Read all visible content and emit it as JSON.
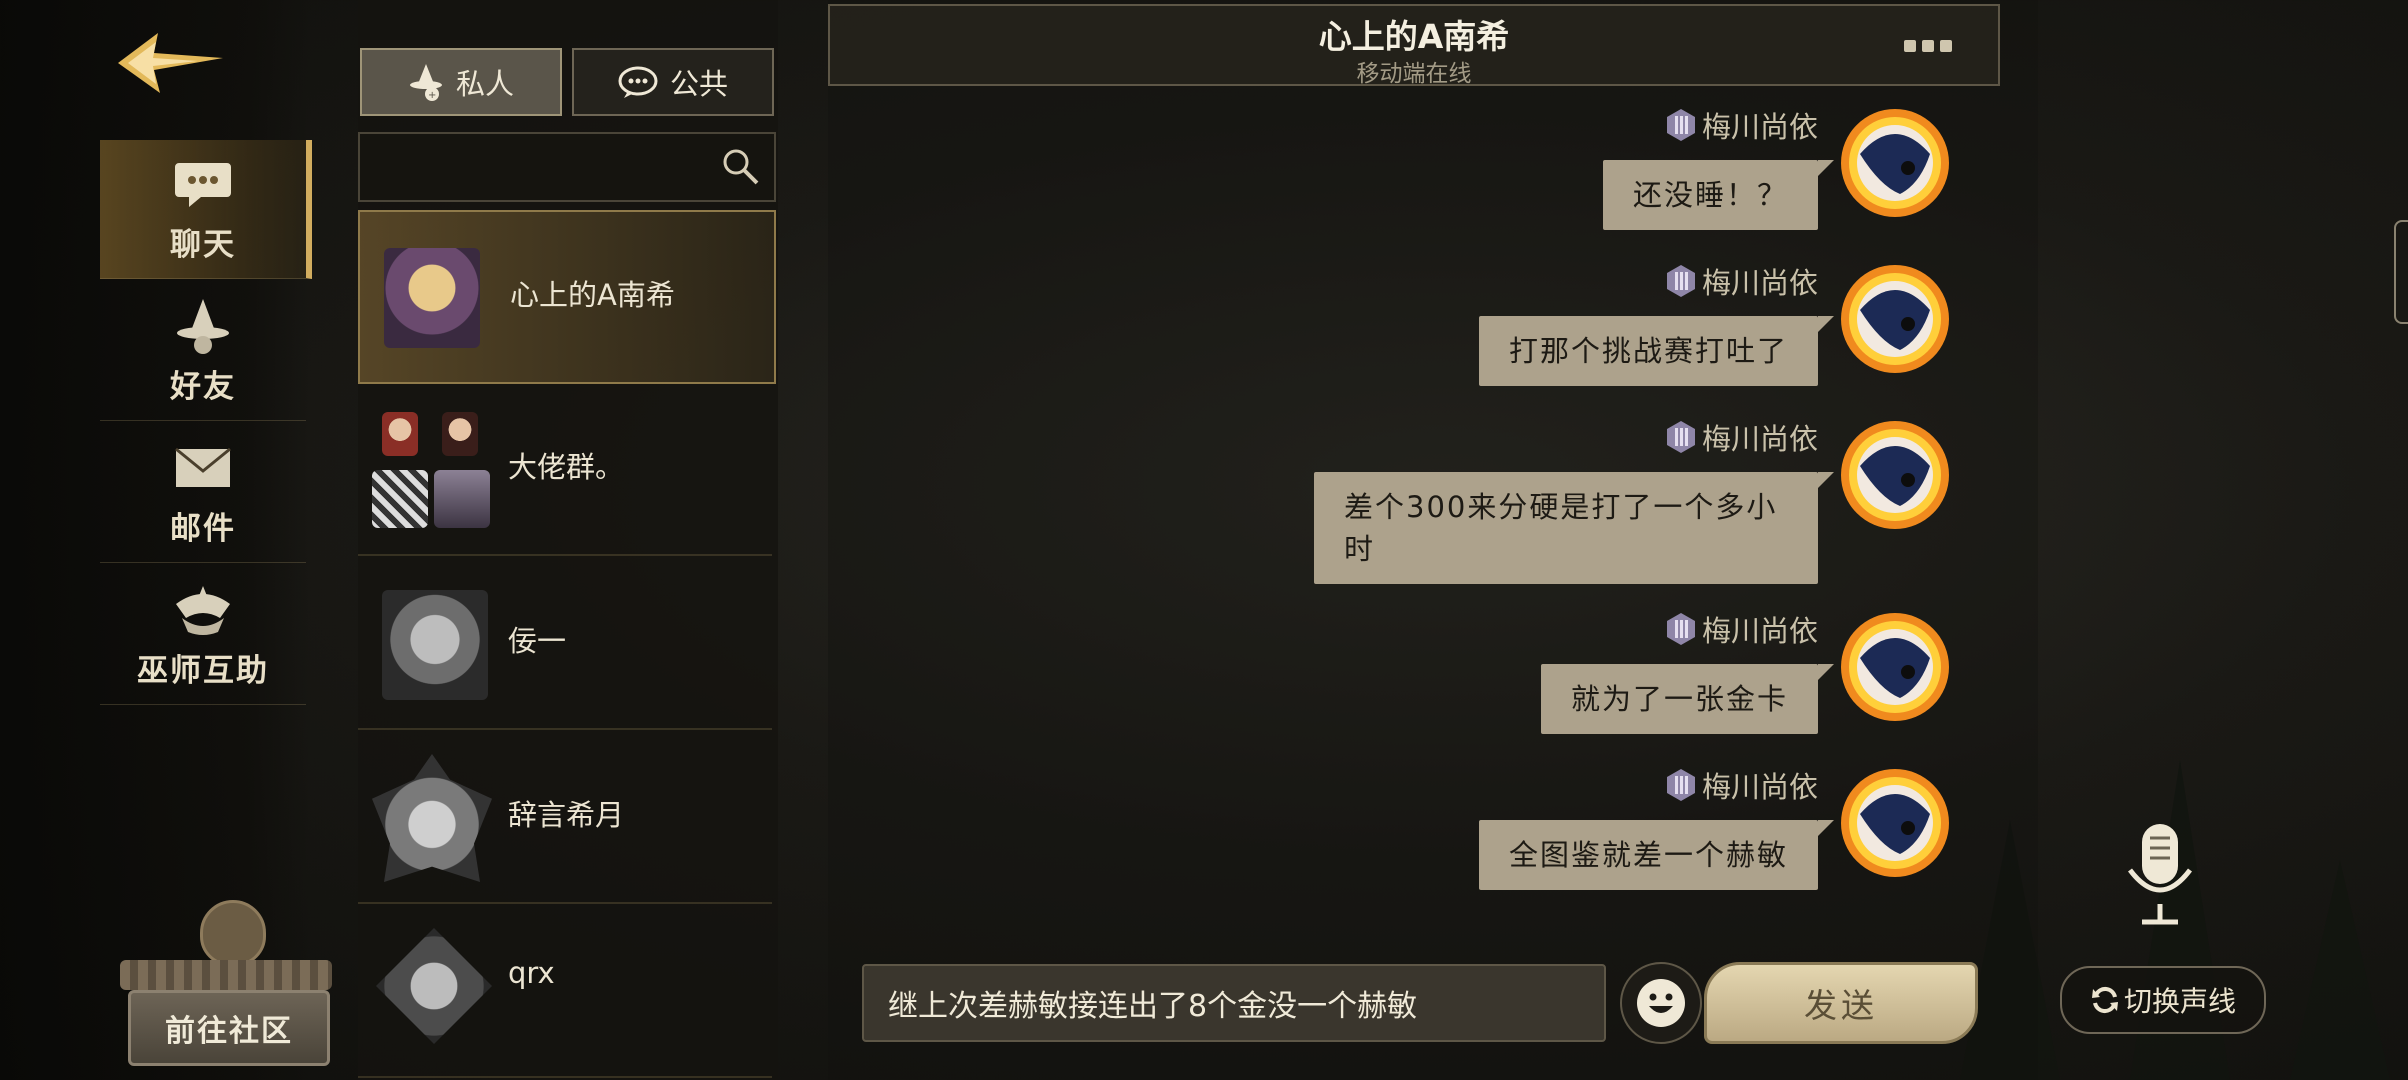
{
  "nav": {
    "items": [
      {
        "label": "聊天",
        "icon": "chat-bubble-icon",
        "active": true
      },
      {
        "label": "好友",
        "icon": "wizard-hat-icon",
        "active": false
      },
      {
        "label": "邮件",
        "icon": "envelope-icon",
        "active": false
      },
      {
        "label": "巫师互助",
        "icon": "helping-hands-icon",
        "active": false
      }
    ],
    "community_label": "前往社区"
  },
  "tabs": [
    {
      "label": "私人",
      "icon": "private-chat-icon",
      "active": true
    },
    {
      "label": "公共",
      "icon": "public-chat-icon",
      "active": false
    }
  ],
  "search": {
    "placeholder": ""
  },
  "contacts": [
    {
      "name": "心上的A南希",
      "active": true
    },
    {
      "name": "大佬群。",
      "active": false
    },
    {
      "name": "佞一",
      "active": false
    },
    {
      "name": "辞言希月",
      "active": false
    },
    {
      "name": "qrx",
      "active": false
    }
  ],
  "chat": {
    "title": "心上的A南希",
    "status": "移动端在线",
    "messages": [
      {
        "sender": "梅川尚依",
        "text": "还没睡！？"
      },
      {
        "sender": "梅川尚依",
        "text": "打那个挑战赛打吐了"
      },
      {
        "sender": "梅川尚依",
        "text": "差个300来分硬是打了一个多小时"
      },
      {
        "sender": "梅川尚依",
        "text": "就为了一张金卡"
      },
      {
        "sender": "梅川尚依",
        "text": "全图鉴就差一个赫敏"
      }
    ],
    "input_value": "继上次差赫敏接连出了8个金没一个赫敏",
    "send_label": "发送"
  },
  "voice_switch_label": "切换声线",
  "colors": {
    "accent_gold": "#d2ad5f",
    "bubble": "#ada28c",
    "send_button": "#e4d6b0"
  }
}
